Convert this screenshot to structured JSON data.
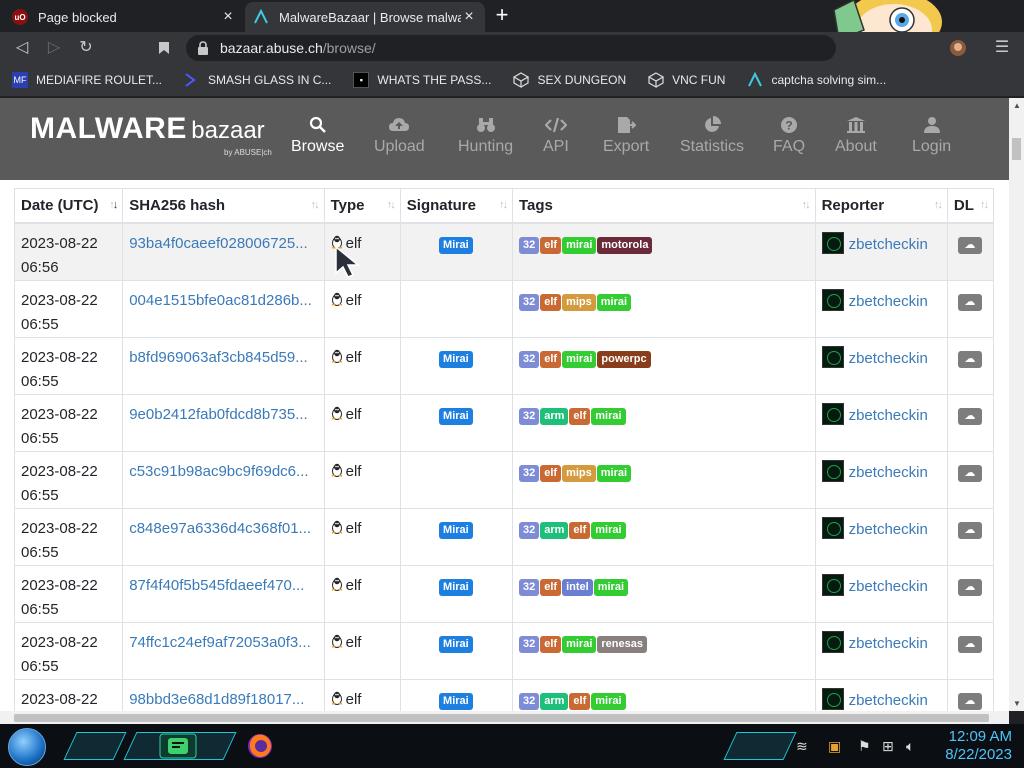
{
  "browser": {
    "tabs": [
      {
        "title": "Page blocked",
        "favicon": "ublock-icon"
      },
      {
        "title": "MalwareBazaar | Browse malware s",
        "favicon": "bazaar-icon"
      }
    ],
    "url_host": "bazaar.abuse.ch",
    "url_path": "/browse/",
    "bookmarks": [
      {
        "label": "MEDIAFIRE ROULET..."
      },
      {
        "label": "SMASH GLASS IN C..."
      },
      {
        "label": "WHATS THE PASS..."
      },
      {
        "label": "SEX DUNGEON"
      },
      {
        "label": "VNC FUN"
      },
      {
        "label": "captcha solving sim..."
      }
    ]
  },
  "site": {
    "brand_main": "MALWARE",
    "brand_sub": "bazaar",
    "brand_by": "by ABUSE|ch",
    "nav": [
      {
        "label": "Browse",
        "icon": "search-icon"
      },
      {
        "label": "Upload",
        "icon": "cloud-upload-icon"
      },
      {
        "label": "Hunting",
        "icon": "binoculars-icon"
      },
      {
        "label": "API",
        "icon": "code-icon"
      },
      {
        "label": "Export",
        "icon": "export-icon"
      },
      {
        "label": "Statistics",
        "icon": "pie-chart-icon"
      },
      {
        "label": "FAQ",
        "icon": "question-icon"
      },
      {
        "label": "About",
        "icon": "building-icon"
      },
      {
        "label": "Login",
        "icon": "user-icon"
      }
    ]
  },
  "table": {
    "headers": [
      "Date (UTC)",
      "SHA256 hash",
      "Type",
      "Signature",
      "Tags",
      "Reporter",
      "DL"
    ],
    "rows": [
      {
        "date": "2023-08-22",
        "time": "06:56",
        "hash": "93ba4f0caeef028006725...",
        "type": "elf",
        "signature": "Mirai",
        "tags": [
          "32",
          "elf",
          "mirai",
          "motorola"
        ],
        "reporter": "zbetcheckin"
      },
      {
        "date": "2023-08-22",
        "time": "06:55",
        "hash": "004e1515bfe0ac81d286b...",
        "type": "elf",
        "signature": "",
        "tags": [
          "32",
          "elf",
          "mips",
          "mirai"
        ],
        "reporter": "zbetcheckin"
      },
      {
        "date": "2023-08-22",
        "time": "06:55",
        "hash": "b8fd969063af3cb845d59...",
        "type": "elf",
        "signature": "Mirai",
        "tags": [
          "32",
          "elf",
          "mirai",
          "powerpc"
        ],
        "reporter": "zbetcheckin"
      },
      {
        "date": "2023-08-22",
        "time": "06:55",
        "hash": "9e0b2412fab0fdcd8b735...",
        "type": "elf",
        "signature": "Mirai",
        "tags": [
          "32",
          "arm",
          "elf",
          "mirai"
        ],
        "reporter": "zbetcheckin"
      },
      {
        "date": "2023-08-22",
        "time": "06:55",
        "hash": "c53c91b98ac9bc9f69dc6...",
        "type": "elf",
        "signature": "",
        "tags": [
          "32",
          "elf",
          "mips",
          "mirai"
        ],
        "reporter": "zbetcheckin"
      },
      {
        "date": "2023-08-22",
        "time": "06:55",
        "hash": "c848e97a6336d4c368f01...",
        "type": "elf",
        "signature": "Mirai",
        "tags": [
          "32",
          "arm",
          "elf",
          "mirai"
        ],
        "reporter": "zbetcheckin"
      },
      {
        "date": "2023-08-22",
        "time": "06:55",
        "hash": "87f4f40f5b545fdaeef470...",
        "type": "elf",
        "signature": "Mirai",
        "tags": [
          "32",
          "elf",
          "intel",
          "mirai"
        ],
        "reporter": "zbetcheckin"
      },
      {
        "date": "2023-08-22",
        "time": "06:55",
        "hash": "74ffc1c24ef9af72053a0f3...",
        "type": "elf",
        "signature": "Mirai",
        "tags": [
          "32",
          "elf",
          "mirai",
          "renesas"
        ],
        "reporter": "zbetcheckin"
      },
      {
        "date": "2023-08-22",
        "time": "",
        "hash": "98bbd3e68d1d89f18017...",
        "type": "elf",
        "signature": "Mirai",
        "tags": [
          "32",
          "arm",
          "elf",
          "mirai"
        ],
        "reporter": "zbetcheckin"
      }
    ]
  },
  "tag_colors": {
    "32": "#7e8cd6",
    "elf": "#c96a34",
    "mirai": "#33cc33",
    "mips": "#d39a3e",
    "motorola": "#6b2a3a",
    "powerpc": "#8a3d1a",
    "arm": "#1ebf7a",
    "intel": "#6b7fd0",
    "renesas": "#8a7f7f"
  },
  "taskbar": {
    "time": "12:09 AM",
    "date": "8/22/2023"
  }
}
